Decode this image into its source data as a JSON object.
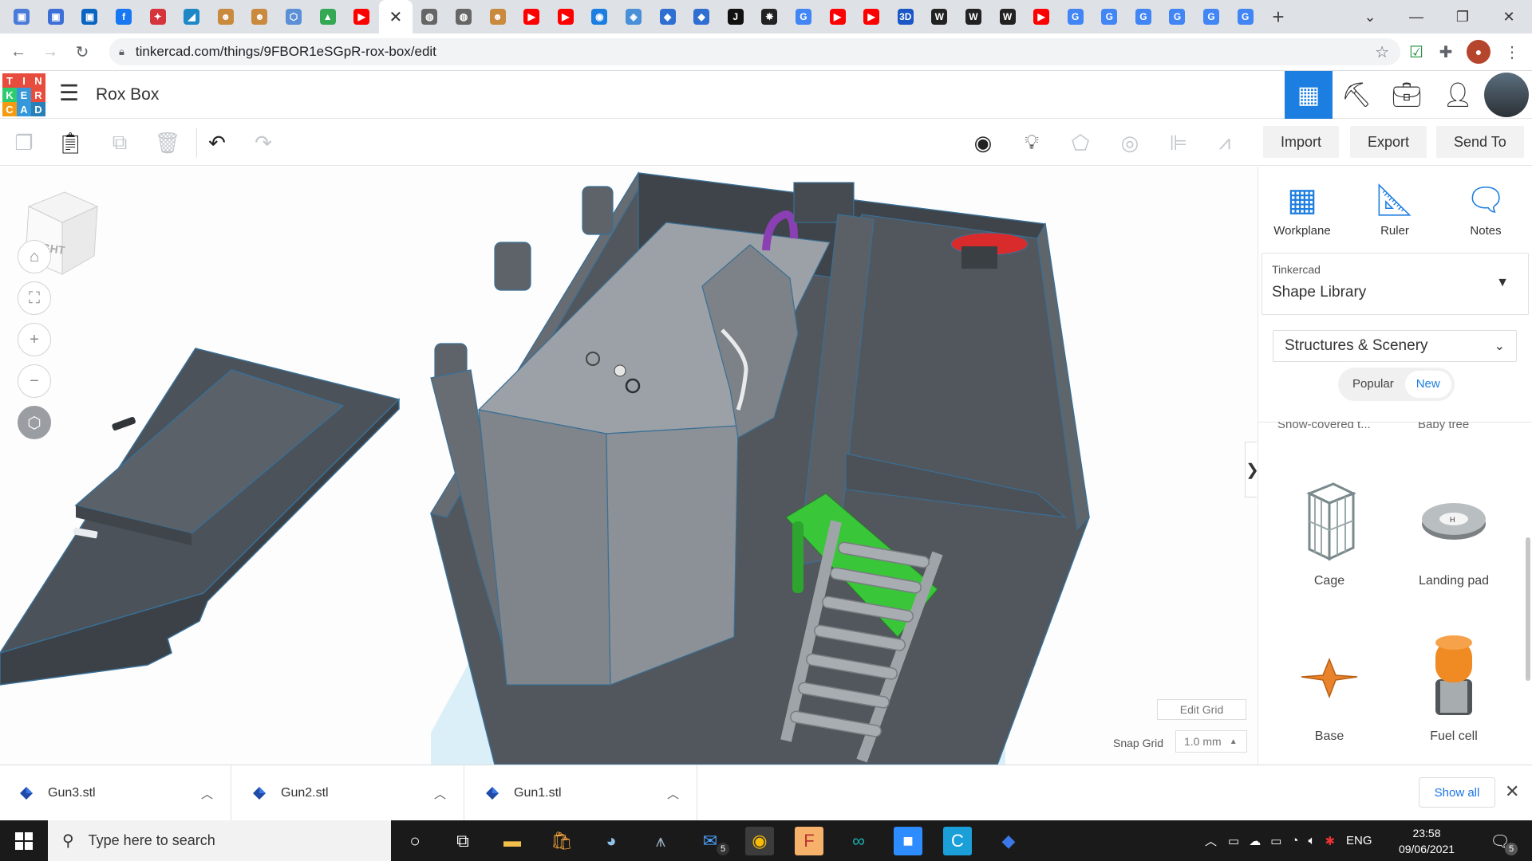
{
  "browser": {
    "url": "tinkercad.com/things/9FBOR1eSGpR-rox-box/edit",
    "tab_favicons": [
      {
        "icon": "google-drive-icon",
        "color": "#4a7bd8",
        "glyph": "▣"
      },
      {
        "icon": "google-docs-icon",
        "color": "#3d6fd6",
        "glyph": "▣"
      },
      {
        "icon": "outlook-icon",
        "color": "#0a64c2",
        "glyph": "▣"
      },
      {
        "icon": "facebook-icon",
        "color": "#1877f2",
        "glyph": "f"
      },
      {
        "icon": "app-icon",
        "color": "#d6343c",
        "glyph": "✦"
      },
      {
        "icon": "edu-icon",
        "color": "#1e88c7",
        "glyph": "◢"
      },
      {
        "icon": "avatar-icon",
        "color": "#c98a3e",
        "glyph": "☻"
      },
      {
        "icon": "avatar-icon",
        "color": "#c98a3e",
        "glyph": "☻"
      },
      {
        "icon": "hex-icon",
        "color": "#5b8fd6",
        "glyph": "⬡"
      },
      {
        "icon": "drive-icon",
        "color": "#34a853",
        "glyph": "▲"
      },
      {
        "icon": "youtube-icon",
        "color": "#ff0000",
        "glyph": "▶"
      }
    ],
    "tab_favicons_right": [
      {
        "icon": "globe-icon",
        "color": "#666",
        "glyph": "◍"
      },
      {
        "icon": "globe-icon",
        "color": "#666",
        "glyph": "◍"
      },
      {
        "icon": "avatar-icon",
        "color": "#c98a3e",
        "glyph": "☻"
      },
      {
        "icon": "youtube-icon",
        "color": "#ff0000",
        "glyph": "▶"
      },
      {
        "icon": "youtube-icon",
        "color": "#ff0000",
        "glyph": "▶"
      },
      {
        "icon": "tinkercad-icon",
        "color": "#1c7ee0",
        "glyph": "◉"
      },
      {
        "icon": "cube-icon",
        "color": "#4a90d9",
        "glyph": "◈"
      },
      {
        "icon": "book-icon",
        "color": "#2f6fd1",
        "glyph": "◆"
      },
      {
        "icon": "book-icon",
        "color": "#2f6fd1",
        "glyph": "◆"
      },
      {
        "icon": "j-icon",
        "color": "#111",
        "glyph": "J"
      },
      {
        "icon": "spider-icon",
        "color": "#222",
        "glyph": "✸"
      },
      {
        "icon": "google-icon",
        "color": "#4285f4",
        "glyph": "G"
      },
      {
        "icon": "youtube-icon",
        "color": "#ff0000",
        "glyph": "▶"
      },
      {
        "icon": "youtube-icon",
        "color": "#ff0000",
        "glyph": "▶"
      },
      {
        "icon": "3d-icon",
        "color": "#1a56c5",
        "glyph": "3D"
      },
      {
        "icon": "wikipedia-icon",
        "color": "#222",
        "glyph": "W"
      },
      {
        "icon": "wikipedia-icon",
        "color": "#222",
        "glyph": "W"
      },
      {
        "icon": "wikipedia-icon",
        "color": "#222",
        "glyph": "W"
      },
      {
        "icon": "youtube-icon",
        "color": "#ff0000",
        "glyph": "▶"
      },
      {
        "icon": "google-icon",
        "color": "#4285f4",
        "glyph": "G"
      },
      {
        "icon": "google-icon",
        "color": "#4285f4",
        "glyph": "G"
      },
      {
        "icon": "google-icon",
        "color": "#4285f4",
        "glyph": "G"
      },
      {
        "icon": "google-icon",
        "color": "#4285f4",
        "glyph": "G"
      },
      {
        "icon": "google-icon",
        "color": "#4285f4",
        "glyph": "G"
      },
      {
        "icon": "google-icon",
        "color": "#4285f4",
        "glyph": "G"
      }
    ]
  },
  "app": {
    "logo_letters": [
      "T",
      "I",
      "N",
      "K",
      "E",
      "R",
      "C",
      "A",
      "D"
    ],
    "logo_colors": [
      "#e74c3c",
      "#e74c3c",
      "#e74c3c",
      "#2ecc71",
      "#3498db",
      "#e74c3c",
      "#f39c12",
      "#3498db",
      "#2980b9"
    ],
    "design_title": "Rox Box",
    "accent": "#1c7ee0"
  },
  "toolbar": {
    "import": "Import",
    "export": "Export",
    "send_to": "Send To"
  },
  "viewcube": {
    "face_label": "RIGHT"
  },
  "workspace": {
    "edit_grid": "Edit Grid",
    "snap_grid_label": "Snap Grid",
    "snap_grid_value": "1.0 mm"
  },
  "panel": {
    "tools": [
      {
        "label": "Workplane",
        "icon": "workplane-icon"
      },
      {
        "label": "Ruler",
        "icon": "ruler-icon"
      },
      {
        "label": "Notes",
        "icon": "notes-icon"
      }
    ],
    "library_provider": "Tinkercad",
    "library_name": "Shape Library",
    "category": "Structures & Scenery",
    "filters": [
      "Popular",
      "New"
    ],
    "selected_filter": "New",
    "cut_labels": [
      "Snow-covered t...",
      "Baby tree"
    ],
    "shapes": [
      {
        "label": "Cage",
        "icon": "cage-shape-icon"
      },
      {
        "label": "Landing pad",
        "icon": "landing-pad-shape-icon"
      },
      {
        "label": "Base",
        "icon": "base-shape-icon"
      },
      {
        "label": "Fuel cell",
        "icon": "fuel-cell-shape-icon"
      }
    ]
  },
  "downloads": {
    "items": [
      "Gun3.stl",
      "Gun2.stl",
      "Gun1.stl"
    ],
    "show_all": "Show all"
  },
  "taskbar": {
    "search_placeholder": "Type here to search",
    "language": "ENG",
    "time": "23:58",
    "date": "09/06/2021",
    "mail_badge": "5",
    "notification_badge": "5"
  }
}
